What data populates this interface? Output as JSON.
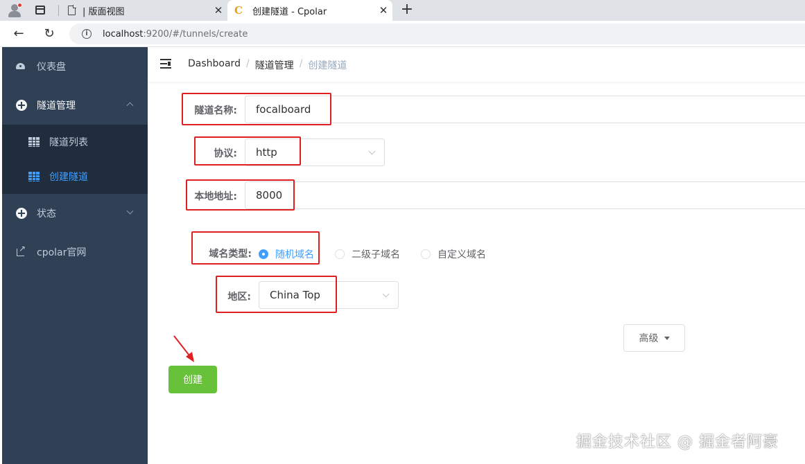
{
  "browser": {
    "tabs": [
      {
        "title": "| 版面视图",
        "active": false
      },
      {
        "title": "创建隧道 - Cpolar",
        "active": true
      }
    ],
    "url_host": "localhost",
    "url_rest": ":9200/#/tunnels/create"
  },
  "sidebar": {
    "items": [
      {
        "label": "仪表盘",
        "icon": "dashboard-icon"
      },
      {
        "label": "隧道管理",
        "icon": "plus-circle-icon",
        "expanded": true
      },
      {
        "label": "隧道列表",
        "icon": "grid-icon"
      },
      {
        "label": "创建隧道",
        "icon": "grid-icon",
        "active": true
      },
      {
        "label": "状态",
        "icon": "plus-circle-icon",
        "expanded": false
      },
      {
        "label": "cpolar官网",
        "icon": "external-link-icon"
      }
    ]
  },
  "breadcrumb": {
    "home": "Dashboard",
    "parent": "隧道管理",
    "current": "创建隧道"
  },
  "form": {
    "name_label": "隧道名称:",
    "name_value": "focalboard",
    "protocol_label": "协议:",
    "protocol_value": "http",
    "port_label": "本地地址:",
    "port_value": "8000",
    "domain_type_label": "域名类型:",
    "domain_types": [
      "随机域名",
      "二级子域名",
      "自定义域名"
    ],
    "domain_type_selected": "随机域名",
    "region_label": "地区:",
    "region_value": "China Top",
    "advanced_label": "高级",
    "create_label": "创建"
  },
  "watermark": "掘金技术社区 @ 掘金者阿豪",
  "colors": {
    "sidebar_bg": "#304156",
    "submenu_bg": "#1f2d3d",
    "accent": "#409eff",
    "create_green": "#67c23a",
    "annotation_red": "#e02020"
  }
}
